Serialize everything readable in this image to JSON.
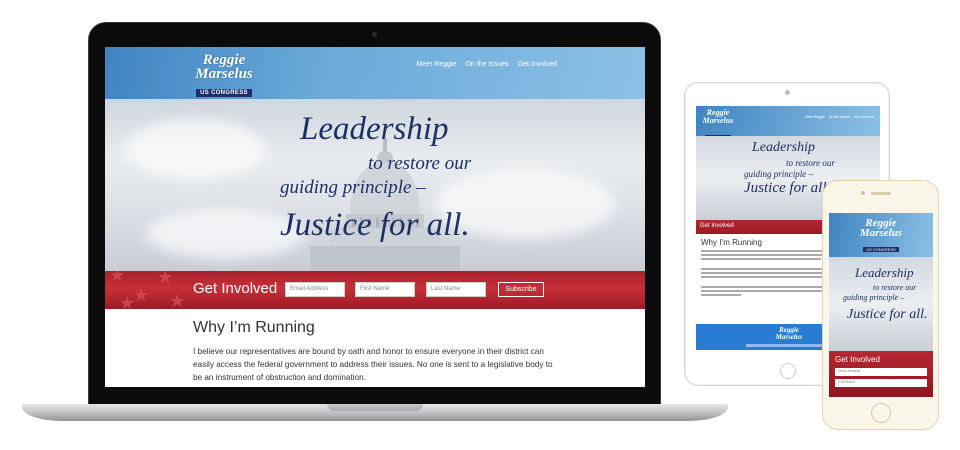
{
  "brand": {
    "name_line1": "Reggie",
    "name_line2": "Marselus",
    "badge": "US CONGRESS"
  },
  "nav": {
    "items": [
      "Meet Reggie",
      "On the Issues",
      "Get Involved"
    ]
  },
  "hero": {
    "line1": "Leadership",
    "line2": "to restore our",
    "line3": "guiding principle –",
    "line4": "Justice for all."
  },
  "get_involved": {
    "title": "Get Involved",
    "email_placeholder": "Email Address",
    "first_name_placeholder": "First Name",
    "last_name_placeholder": "Last Name",
    "subscribe_label": "Subscribe"
  },
  "content": {
    "heading": "Why I’m Running",
    "paragraph": "I believe our representatives are bound by oath and honor to ensure everyone in their district can easily access the federal government to address their issues. No one is sent to a legislative body to be an instrument of obstruction and domination."
  },
  "colors": {
    "header_blue": "#4a8fcc",
    "navy": "#1e2f63",
    "band_red": "#b52732",
    "footer_blue": "#2a7bd3"
  }
}
